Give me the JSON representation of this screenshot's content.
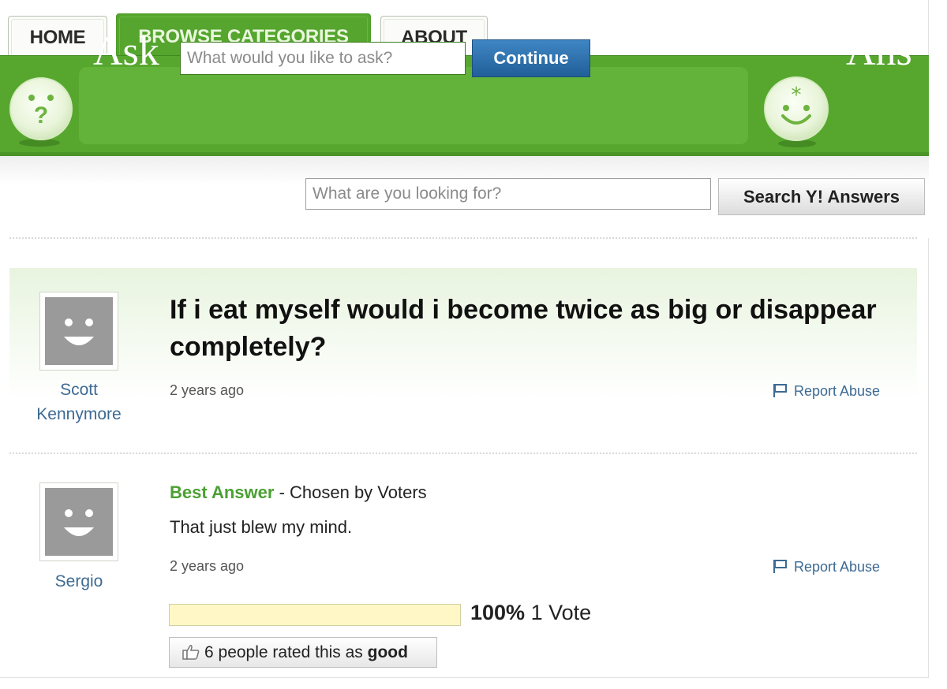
{
  "nav": {
    "tabs": [
      {
        "label": "HOME",
        "active": false
      },
      {
        "label": "BROWSE CATEGORIES",
        "active": true
      },
      {
        "label": "ABOUT",
        "active": false
      }
    ]
  },
  "header": {
    "ask_label": "Ask",
    "ask_placeholder": "What would you like to ask?",
    "continue_label": "Continue",
    "answers_label": "Ans",
    "ask_icon": "question-face-icon",
    "answers_icon": "smiley-face-icon"
  },
  "search": {
    "placeholder": "What are you looking for?",
    "button_label": "Search Y! Answers"
  },
  "question": {
    "title": "If i eat myself would i become twice as big or disappear completely?",
    "author_line1": "Scott",
    "author_line2": "Kennymore",
    "time": "2 years ago",
    "report_label": "Report Abuse"
  },
  "answer": {
    "best_label": "Best Answer",
    "chosen_by": " - Chosen by Voters",
    "text": "That just blew my mind.",
    "author": "Sergio",
    "time": "2 years ago",
    "report_label": "Report Abuse",
    "vote_percent_label": "100%",
    "vote_count_label": "1 Vote",
    "vote_fraction": 1.0,
    "rating_prefix": "6 people rated this as ",
    "rating_word": "good"
  },
  "colors": {
    "brand_green": "#57a72f",
    "best_answer_green": "#4aa032",
    "link_blue": "#3d6a93",
    "continue_blue": "#2d6fae"
  }
}
